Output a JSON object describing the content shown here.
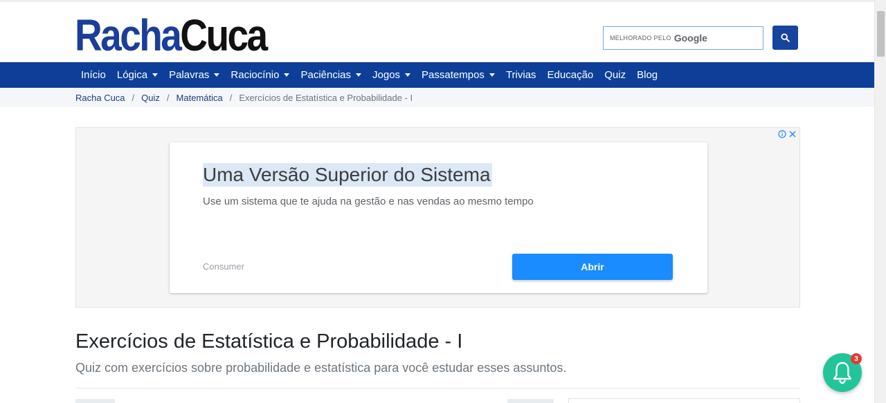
{
  "header": {
    "logo_part1": "Racha",
    "logo_part2": "Cuca",
    "search": {
      "prefix": "MELHORADO PELO",
      "provider": "Google",
      "button_icon": "search-icon"
    }
  },
  "nav": {
    "items": [
      {
        "label": "Início",
        "dropdown": false
      },
      {
        "label": "Lógica",
        "dropdown": true
      },
      {
        "label": "Palavras",
        "dropdown": true
      },
      {
        "label": "Raciocínio",
        "dropdown": true
      },
      {
        "label": "Paciências",
        "dropdown": true
      },
      {
        "label": "Jogos",
        "dropdown": true
      },
      {
        "label": "Passatempos",
        "dropdown": true
      },
      {
        "label": "Trivias",
        "dropdown": false
      },
      {
        "label": "Educação",
        "dropdown": false
      },
      {
        "label": "Quiz",
        "dropdown": false
      },
      {
        "label": "Blog",
        "dropdown": false
      }
    ]
  },
  "breadcrumb": {
    "items": [
      "Racha Cuca",
      "Quiz",
      "Matemática"
    ],
    "current": "Exercícios de Estatística e Probabilidade - I"
  },
  "ad": {
    "title": "Uma Versão Superior do Sistema",
    "description": "Use um sistema que te ajuda na gestão e nas vendas ao mesmo tempo",
    "source": "Consumer",
    "cta": "Abrir"
  },
  "main": {
    "title": "Exercícios de Estatística e Probabilidade - I",
    "subtitle": "Quiz com exercícios sobre probabilidade e estatística para você estudar esses assuntos."
  },
  "notification": {
    "count": "3"
  },
  "colors": {
    "brand_blue": "#0d3f98",
    "logo_blue": "#1a3e9a",
    "ad_cta": "#1a8cff",
    "bell": "#22c59a",
    "badge": "#e53935"
  }
}
